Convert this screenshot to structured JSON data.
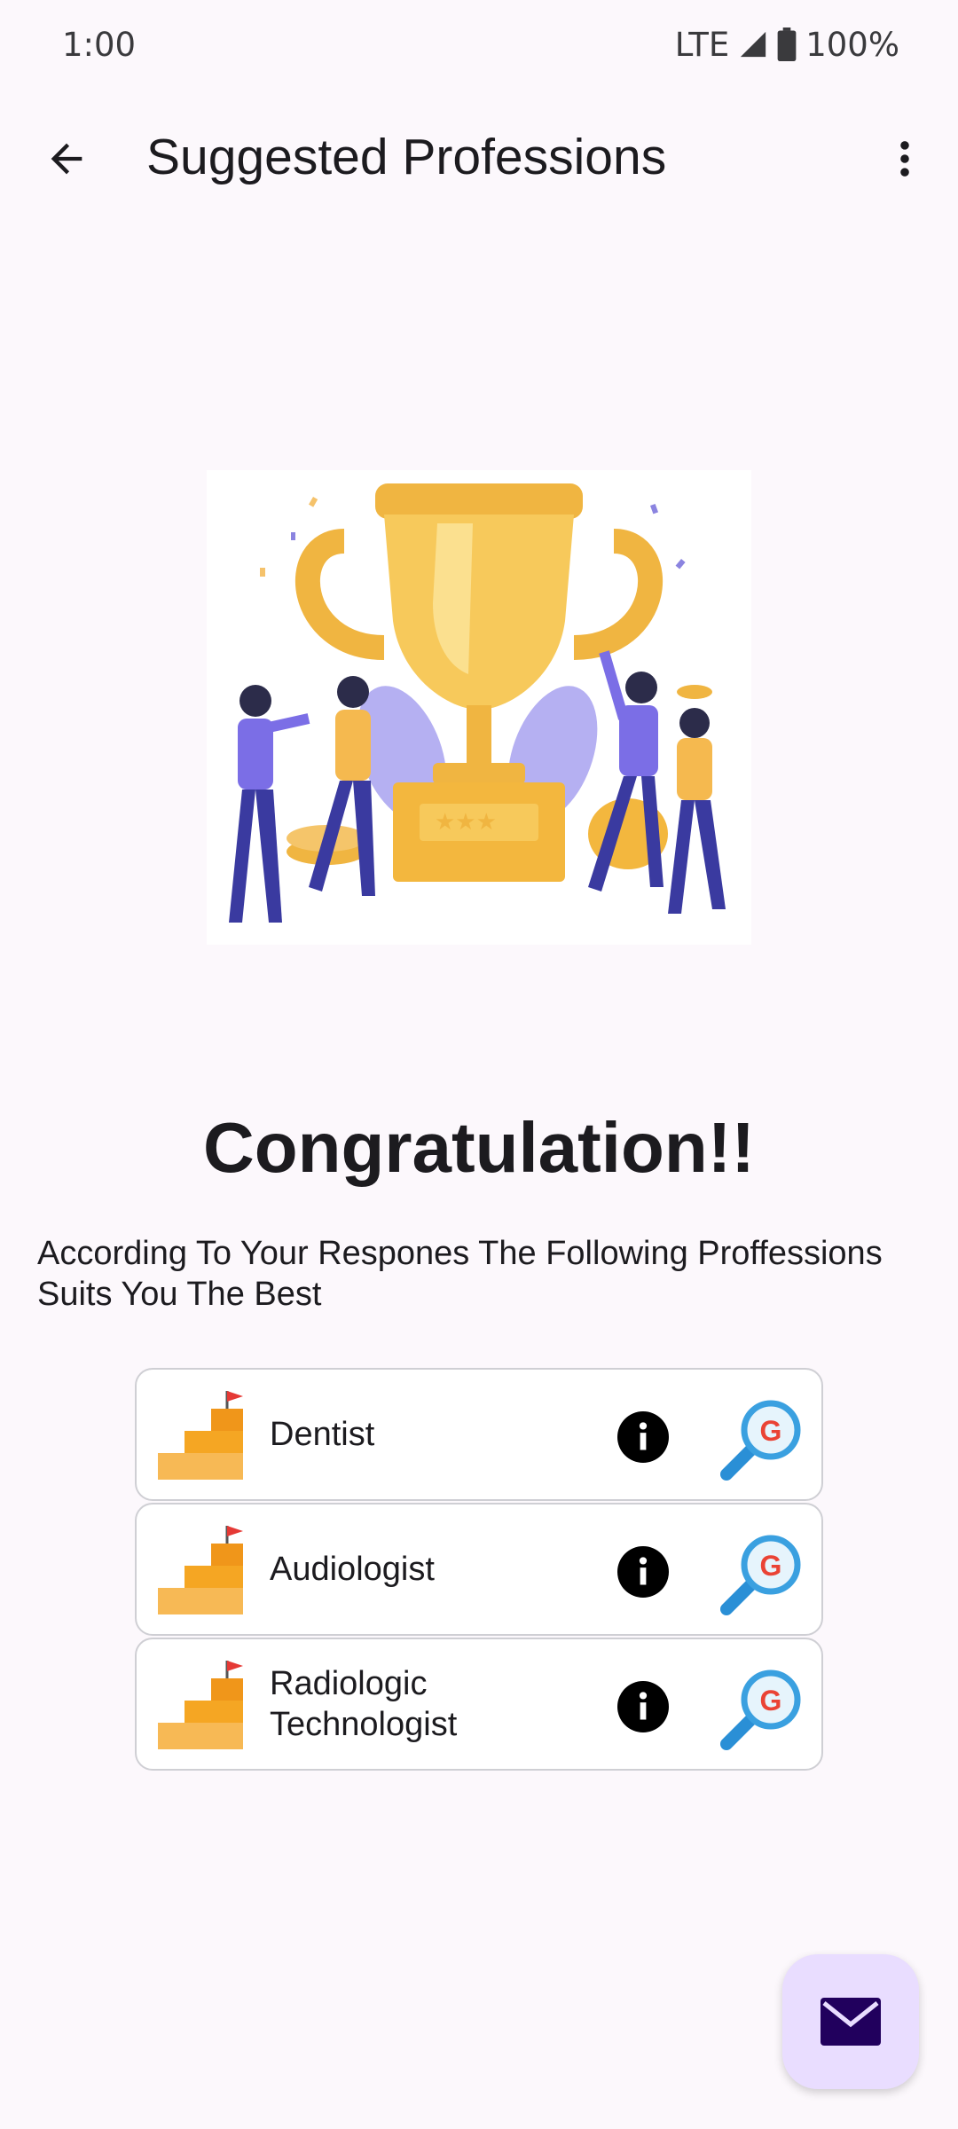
{
  "status_bar": {
    "time": "1:00",
    "network": "LTE",
    "battery": "100%"
  },
  "app_bar": {
    "title": "Suggested Professions",
    "back_icon": "arrow-back-icon",
    "menu_icon": "more-vert-icon"
  },
  "main": {
    "heading": "Congratulation!!",
    "description": "According To Your Respones The Following Proffessions Suits You The Best"
  },
  "professions": [
    {
      "name": "Dentist"
    },
    {
      "name": "Audiologist"
    },
    {
      "name": "Radiologic Technologist"
    }
  ],
  "fab": {
    "icon": "mail-icon"
  },
  "colors": {
    "background": "#fcf8fc",
    "fab": "#e9ddff",
    "fab_icon": "#21005d",
    "stairs": "#f5a623"
  }
}
